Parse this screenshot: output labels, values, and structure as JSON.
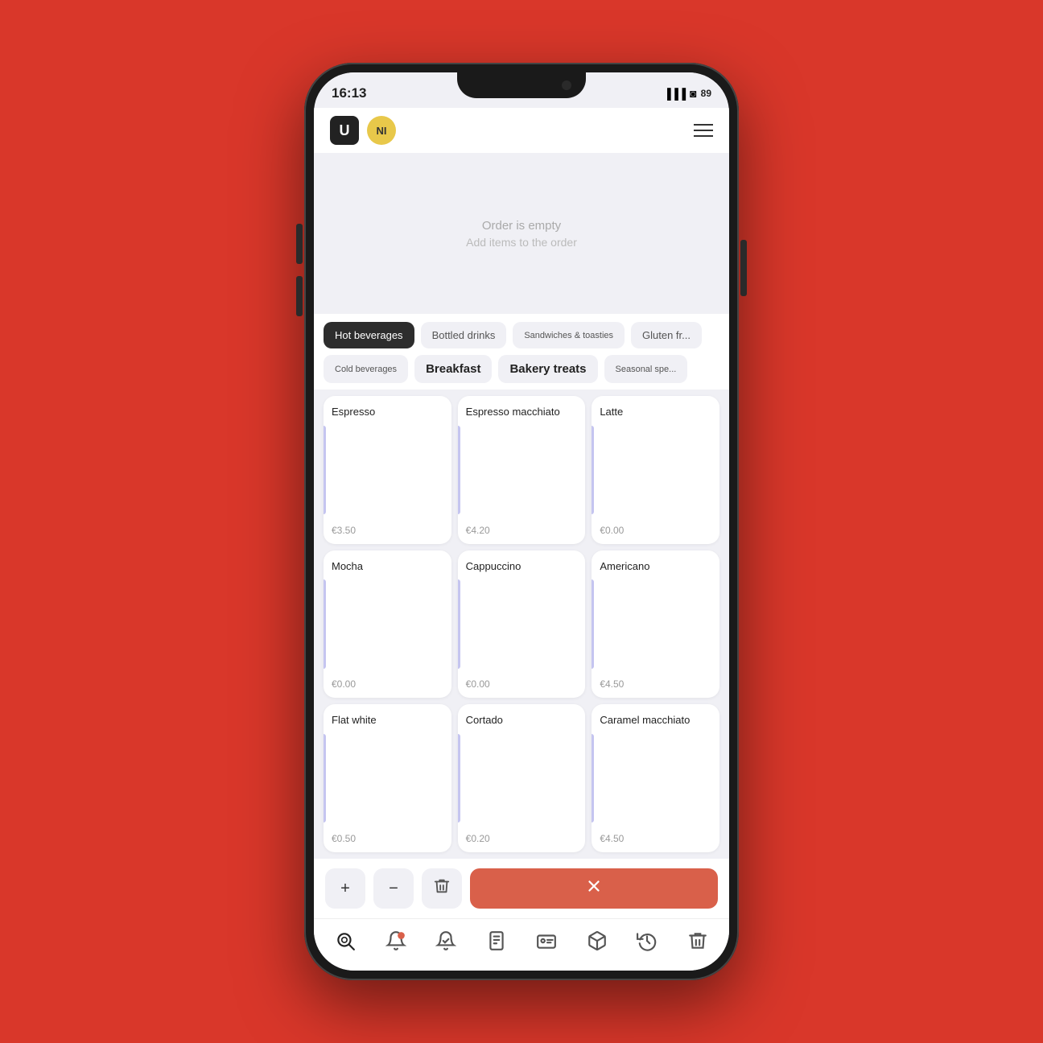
{
  "phone": {
    "status": {
      "time": "16:13",
      "battery": "89",
      "wifi": "WiFi",
      "signal": "signal"
    }
  },
  "header": {
    "logo_text": "U",
    "avatar_initials": "NI",
    "menu_label": "menu"
  },
  "order": {
    "empty_title": "Order is empty",
    "empty_subtitle": "Add items to the order"
  },
  "categories": {
    "row1": [
      {
        "id": "hot-beverages",
        "label": "Hot beverages",
        "active": true,
        "bold": false
      },
      {
        "id": "bottled-drinks",
        "label": "Bottled drinks",
        "active": false,
        "bold": false
      },
      {
        "id": "sandwiches",
        "label": "Sandwiches & toasties",
        "active": false,
        "bold": false
      },
      {
        "id": "gluten-free",
        "label": "Gluten fr...",
        "active": false,
        "bold": false
      }
    ],
    "row2": [
      {
        "id": "cold-beverages",
        "label": "Cold beverages",
        "active": false,
        "bold": false
      },
      {
        "id": "breakfast",
        "label": "Breakfast",
        "active": false,
        "bold": true
      },
      {
        "id": "bakery-treats",
        "label": "Bakery treats",
        "active": false,
        "bold": true
      },
      {
        "id": "seasonal",
        "label": "Seasonal spe...",
        "active": false,
        "bold": false
      }
    ]
  },
  "menu_items": [
    {
      "name": "Espresso",
      "price": "€3.50"
    },
    {
      "name": "Espresso macchiato",
      "price": "€4.20"
    },
    {
      "name": "Latte",
      "price": "€0.00"
    },
    {
      "name": "Mocha",
      "price": "€0.00"
    },
    {
      "name": "Cappuccino",
      "price": "€0.00"
    },
    {
      "name": "Americano",
      "price": "€4.50"
    },
    {
      "name": "Flat white",
      "price": "€0.50"
    },
    {
      "name": "Cortado",
      "price": "€0.20"
    },
    {
      "name": "Caramel macchiato",
      "price": "€4.50"
    }
  ],
  "action_bar": {
    "add_label": "+",
    "minus_label": "−",
    "delete_label": "🗑",
    "cancel_label": "✕"
  },
  "bottom_nav": {
    "items": [
      {
        "id": "search",
        "label": "search"
      },
      {
        "id": "order",
        "label": "order"
      },
      {
        "id": "delivery",
        "label": "delivery"
      },
      {
        "id": "receipt",
        "label": "receipt"
      },
      {
        "id": "id-card",
        "label": "id-card"
      },
      {
        "id": "box",
        "label": "box"
      },
      {
        "id": "history",
        "label": "history"
      },
      {
        "id": "trash",
        "label": "trash"
      }
    ]
  }
}
